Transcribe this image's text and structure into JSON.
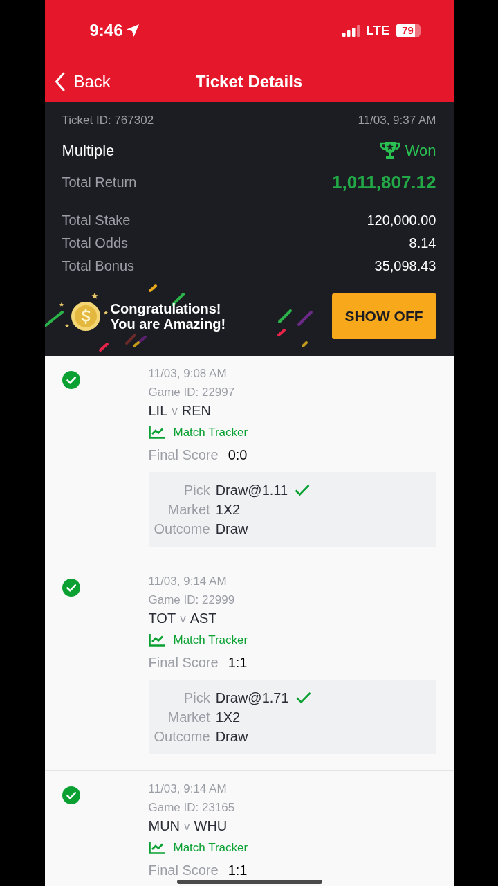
{
  "status_bar": {
    "time": "9:46",
    "network": "LTE",
    "battery": "79"
  },
  "nav": {
    "back": "Back",
    "title": "Ticket Details"
  },
  "ticket": {
    "id": "Ticket ID: 767302",
    "date": "11/03, 9:37 AM",
    "type": "Multiple",
    "won": true,
    "status_label": "Won",
    "return_label": "Total Return",
    "return_value": "1,011,807.12",
    "rows": [
      {
        "label": "Total Stake",
        "value": "120,000.00"
      },
      {
        "label": "Total Odds",
        "value": "8.14"
      },
      {
        "label": "Total Bonus",
        "value": "35,098.43"
      }
    ]
  },
  "banner": {
    "lines": [
      "Congratulations!",
      "You are Amazing!"
    ],
    "button": "SHOW OFF"
  },
  "games": [
    {
      "won": true,
      "time": "11/03, 9:08 AM",
      "game_id": "Game ID: 22997",
      "home": "LIL",
      "vs": "v",
      "away": "REN",
      "tracker": "Match Tracker",
      "score_label": "Final Score",
      "score": "0:0",
      "pick_label": "Pick",
      "pick": "Draw@1.11",
      "pick_correct": true,
      "market_label": "Market",
      "market": "1X2",
      "outcome_label": "Outcome",
      "outcome": "Draw"
    },
    {
      "won": true,
      "time": "11/03, 9:14 AM",
      "game_id": "Game ID: 22999",
      "home": "TOT",
      "vs": "v",
      "away": "AST",
      "tracker": "Match Tracker",
      "score_label": "Final Score",
      "score": "1:1",
      "pick_label": "Pick",
      "pick": "Draw@1.71",
      "pick_correct": true,
      "market_label": "Market",
      "market": "1X2",
      "outcome_label": "Outcome",
      "outcome": "Draw"
    },
    {
      "won": true,
      "time": "11/03, 9:14 AM",
      "game_id": "Game ID: 23165",
      "home": "MUN",
      "vs": "v",
      "away": "WHU",
      "tracker": "Match Tracker",
      "score_label": "Final Score",
      "score": "1:1"
    }
  ]
}
